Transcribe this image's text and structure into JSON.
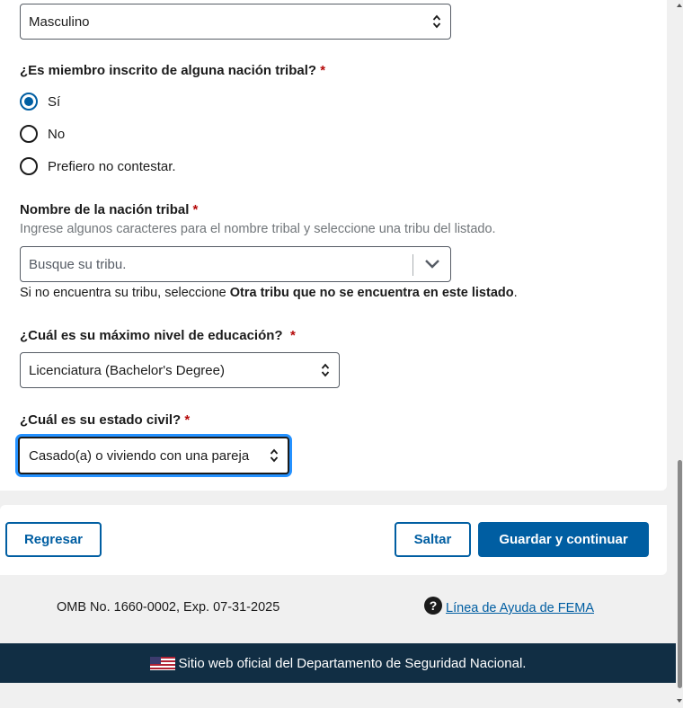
{
  "form": {
    "gender_select": {
      "value": "Masculino"
    },
    "tribal_question": {
      "label": "¿Es miembro inscrito de alguna nación tribal?",
      "required_mark": "*",
      "options": [
        {
          "label": "Sí",
          "checked": true
        },
        {
          "label": "No",
          "checked": false
        },
        {
          "label": "Prefiero no contestar.",
          "checked": false
        }
      ]
    },
    "tribe_name": {
      "label": "Nombre de la nación tribal",
      "required_mark": "*",
      "hint": "Ingrese algunos caracteres para el nombre tribal y seleccione una tribu del listado.",
      "placeholder": "Busque su tribu.",
      "note_prefix": "Si no encuentra su tribu, seleccione ",
      "note_bold": "Otra tribu que no se encuentra en este listado",
      "note_suffix": "."
    },
    "education": {
      "label": "¿Cuál es su máximo nivel de educación?",
      "required_mark": "*",
      "value": "Licenciatura (Bachelor's Degree)"
    },
    "marital_status": {
      "label": "¿Cuál es su estado civil?",
      "required_mark": "*",
      "value": "Casado(a) o viviendo con una pareja"
    }
  },
  "actions": {
    "back_label": "Regresar",
    "skip_label": "Saltar",
    "save_label": "Guardar y continuar"
  },
  "footer": {
    "omb_text": "OMB No. 1660-0002, Exp. 07-31-2025",
    "help_link": "Línea de Ayuda de FEMA",
    "help_icon": "question-circle-icon",
    "banner_text": "Sitio web oficial del Departamento de Seguridad Nacional.",
    "banner_icon": "us-flag-icon"
  },
  "colors": {
    "primary": "#005ea2",
    "required": "#b50909",
    "banner_bg": "#112e44",
    "focus_ring": "#2491ff"
  }
}
